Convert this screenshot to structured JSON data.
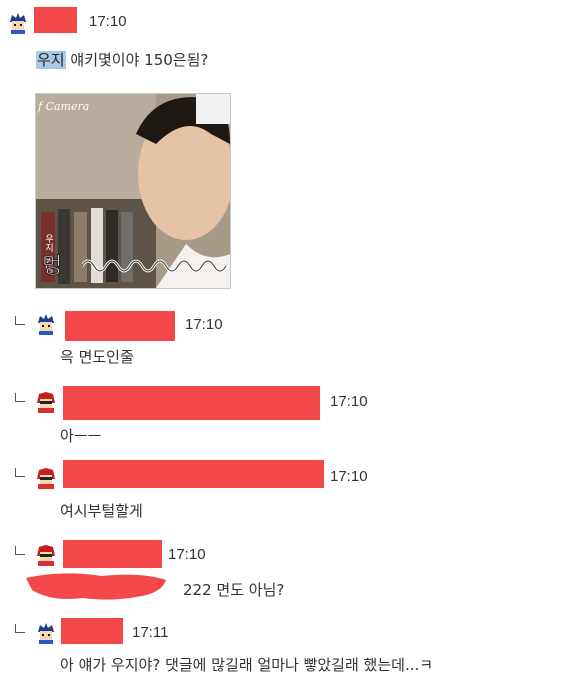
{
  "thread": {
    "post": {
      "time": "17:10",
      "mention": "우지",
      "text": "얘키몇이야 150은됨?",
      "photo": {
        "watermark": "f Camera",
        "caption_big": "멍",
        "caption_small": "우지 멍멍"
      }
    },
    "comments": [
      {
        "avatar": "blue-avatar",
        "time": "17:10",
        "text": "윽 면도인줄"
      },
      {
        "avatar": "red-avatar",
        "time": "17:10",
        "text": "아ㅡㅡ"
      },
      {
        "avatar": "red-avatar",
        "time": "17:10",
        "text": "여시부털할게"
      },
      {
        "avatar": "red-avatar",
        "time": "17:10",
        "text": "222 면도 아님?"
      },
      {
        "avatar": "blue-avatar",
        "time": "17:11",
        "text": "아 얘가 우지야? 댓글에 많길래 얼마나 빻았길래 했는데...ㅋ"
      }
    ]
  },
  "colors": {
    "redaction": "#f2484a",
    "highlight": "#a9c9ea"
  }
}
